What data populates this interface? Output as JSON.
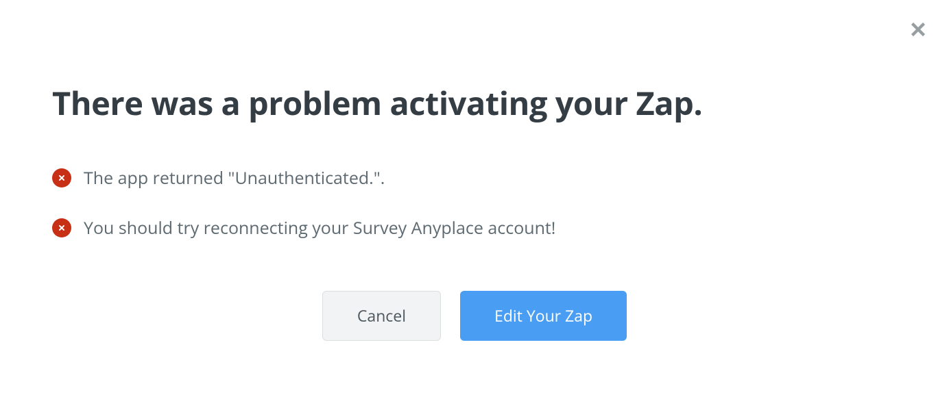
{
  "modal": {
    "title": "There was a problem activating your Zap.",
    "errors": [
      "The app returned \"Unauthenticated.\".",
      "You should try reconnecting your Survey Anyplace account!"
    ],
    "buttons": {
      "cancel": "Cancel",
      "primary": "Edit Your Zap"
    }
  }
}
